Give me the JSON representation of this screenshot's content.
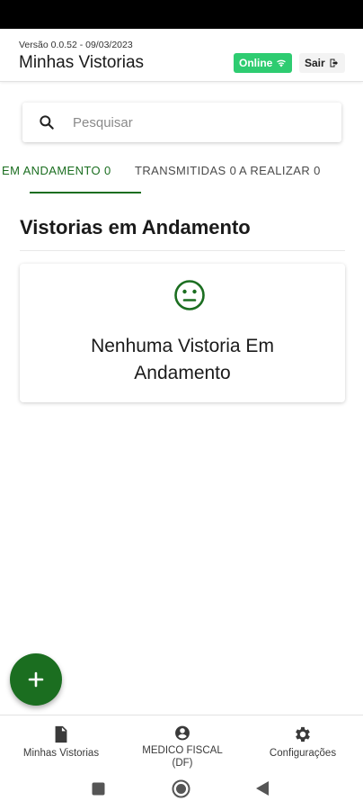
{
  "header": {
    "version": "Versão 0.0.52 - 09/03/2023",
    "title": "Minhas Vistorias",
    "online_label": "Online",
    "logout_label": "Sair"
  },
  "search": {
    "placeholder": "Pesquisar",
    "value": ""
  },
  "tabs": [
    {
      "label": "EM ANDAMENTO 0",
      "active": true
    },
    {
      "label": "TRANSMITIDAS 0",
      "active": false
    },
    {
      "label": "A REALIZAR 0",
      "active": false
    }
  ],
  "section": {
    "title": "Vistorias em Andamento"
  },
  "empty_state": {
    "icon": "neutral-face-icon",
    "message": "Nenhuma Vistoria Em\nAndamento"
  },
  "fab": {
    "icon": "plus-icon"
  },
  "bottom_nav": [
    {
      "label": "Minhas Vistorias",
      "icon": "document-icon"
    },
    {
      "label": "MEDICO FISCAL\n(DF)",
      "icon": "account-circle-icon"
    },
    {
      "label": "Configurações",
      "icon": "gear-icon"
    }
  ],
  "colors": {
    "primary": "#1b6e20",
    "online_badge": "#2ecc71",
    "status_bar": "#000000"
  }
}
